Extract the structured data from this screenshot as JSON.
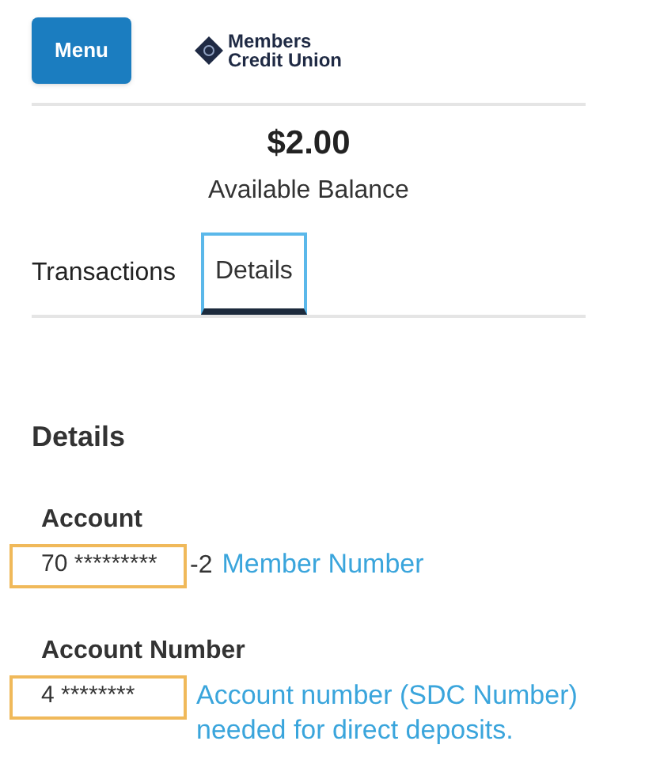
{
  "header": {
    "menu_button": "Menu",
    "logo": {
      "line_1": "Members",
      "line_2": "Credit Union"
    }
  },
  "balance": {
    "amount": "$2.00",
    "label": "Available Balance"
  },
  "tabs": [
    {
      "label": "Transactions",
      "selected": false
    },
    {
      "label": "Details",
      "selected": true
    }
  ],
  "details": {
    "heading": "Details",
    "fields": [
      {
        "label": "Account",
        "value": "70 *********",
        "suffix": "-2",
        "note": "Member Number"
      },
      {
        "label": "Account Number",
        "value": "4 ********",
        "note": "Account number (SDC Number) needed for direct deposits."
      }
    ]
  }
}
